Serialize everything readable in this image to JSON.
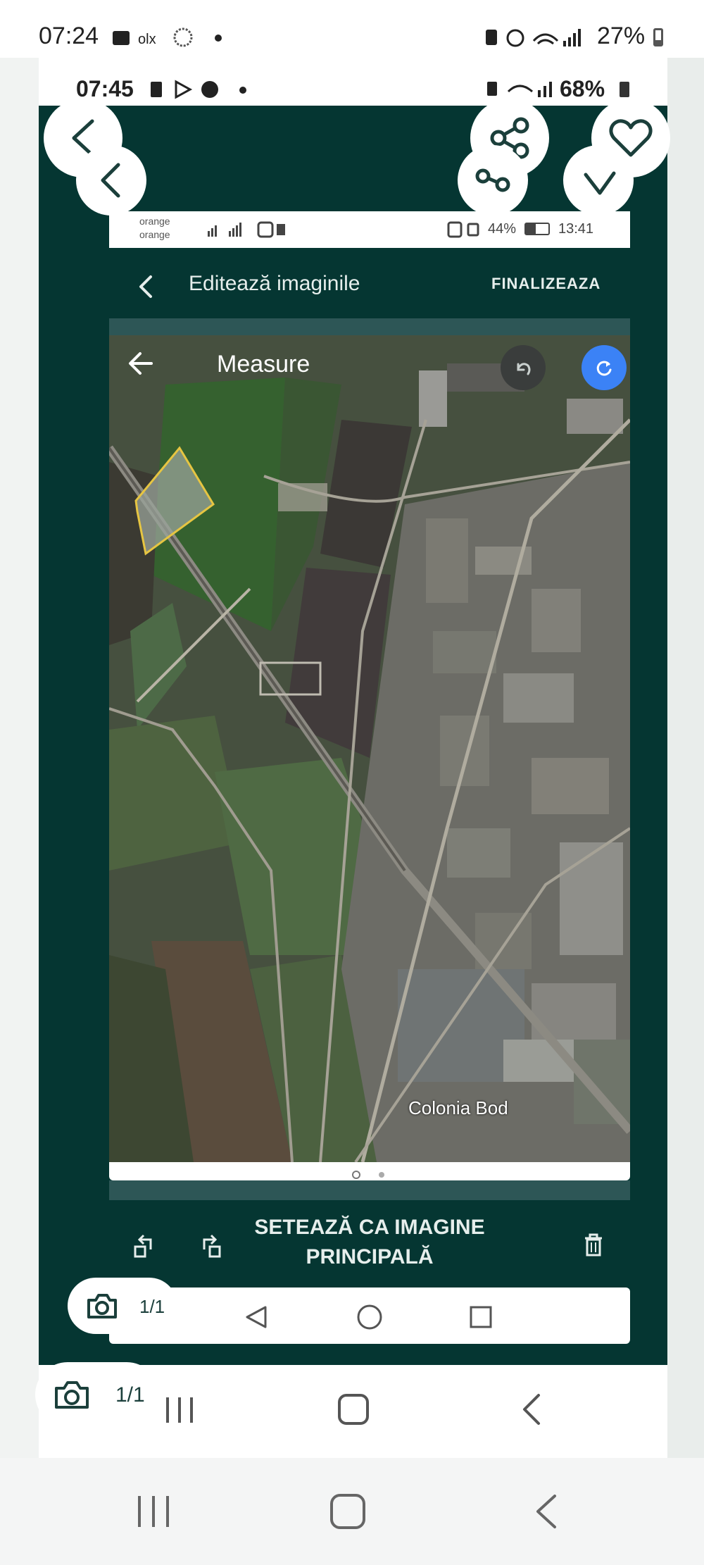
{
  "outer_status": {
    "time": "07:24",
    "battery": "27%"
  },
  "middle_status": {
    "time": "07:45",
    "battery": "68%"
  },
  "inner_status": {
    "carrier1": "orange",
    "carrier2": "orange",
    "battery": "44%",
    "time": "13:41"
  },
  "editor": {
    "title": "Editează imaginile",
    "finish_label": "FINALIZEAZA"
  },
  "maps": {
    "title": "Measure",
    "place_label": "Colonia Bod"
  },
  "actions": {
    "set_main_line1": "SETEAZĂ CA IMAGINE",
    "set_main_line2": "PRINCIPALĂ"
  },
  "photo_counter_inner": "1/1",
  "photo_counter_outer": "1/1",
  "colors": {
    "dark_teal": "#053632",
    "field_outline": "#e6c542",
    "accent_blue": "#3b82f6"
  },
  "icons": [
    "back-icon",
    "share-icon",
    "heart-icon",
    "camera-icon",
    "trash-icon",
    "rotate-left-icon",
    "rotate-right-icon",
    "undo-icon",
    "refresh-icon"
  ]
}
